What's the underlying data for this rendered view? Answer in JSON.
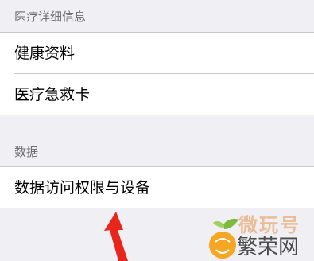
{
  "medical_section": {
    "header": "医疗详细信息",
    "items": [
      {
        "label": "健康资料"
      },
      {
        "label": "医疗急救卡"
      }
    ]
  },
  "data_section": {
    "header": "数据",
    "items": [
      {
        "label": "数据访问权限与设备"
      }
    ]
  },
  "watermark": {
    "line1": "微玩号",
    "line2": "繁荣网"
  },
  "colors": {
    "background": "#efeff4",
    "section_header_text": "#6d6d72",
    "separator": "#c8c7cc",
    "arrow": "#e8261d"
  }
}
